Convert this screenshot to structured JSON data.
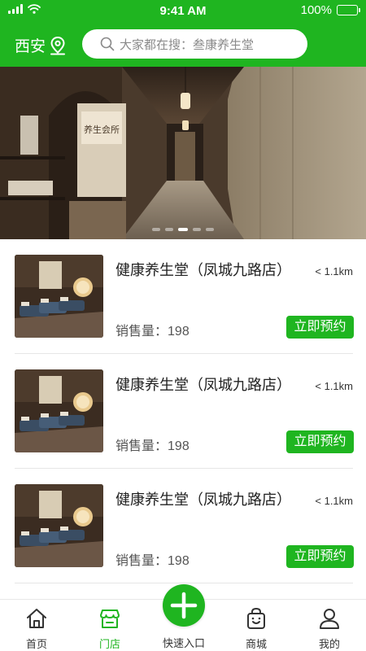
{
  "status": {
    "time": "9:41 AM",
    "battery": "100%"
  },
  "header": {
    "city": "西安",
    "search_placeholder": "大家都在搜：叁康养生堂"
  },
  "banner": {
    "sign_text": "养生会所",
    "active_slide": 3,
    "slide_count": 5
  },
  "stores": [
    {
      "name": "健康养生堂（凤城九路店）",
      "distance": "< 1.1km",
      "sales_label": "销售量：",
      "sales": "198",
      "book_label": "立即预约"
    },
    {
      "name": "健康养生堂（凤城九路店）",
      "distance": "< 1.1km",
      "sales_label": "销售量：",
      "sales": "198",
      "book_label": "立即预约"
    },
    {
      "name": "健康养生堂（凤城九路店）",
      "distance": "< 1.1km",
      "sales_label": "销售量：",
      "sales": "198",
      "book_label": "立即预约"
    }
  ],
  "tabbar": {
    "home": "首页",
    "store": "门店",
    "quick": "快速入口",
    "mall": "商城",
    "mine": "我的"
  },
  "colors": {
    "brand": "#1fb520",
    "active_tab": "#1fb520"
  },
  "icons": [
    "signal-icon",
    "wifi-icon",
    "battery-icon",
    "location-pin-icon",
    "search-icon",
    "home-icon",
    "store-icon",
    "plus-icon",
    "shopping-bag-icon",
    "user-icon"
  ]
}
